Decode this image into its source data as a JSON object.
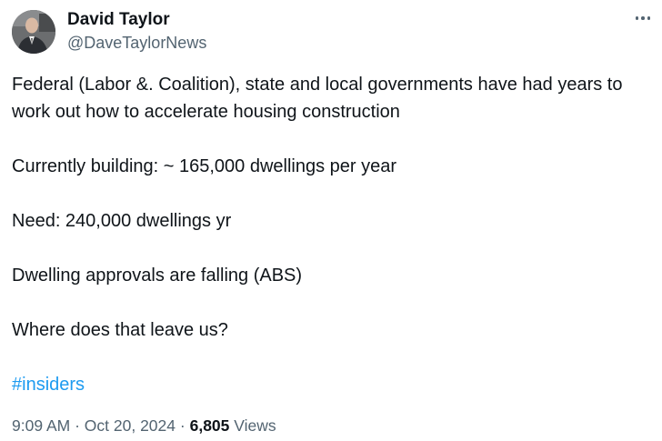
{
  "author": {
    "display_name": "David Taylor",
    "handle": "@DaveTaylorNews"
  },
  "more_menu": {
    "icon": "more-horizontal-icon"
  },
  "tweet": {
    "paragraphs": [
      "Federal (Labor &. Coalition), state and local governments have had years to work out how to accelerate housing construction",
      "Currently building: ~ 165,000 dwellings per year",
      "Need: 240,000 dwellings yr",
      "Dwelling approvals are falling (ABS)",
      "Where does that leave us?"
    ],
    "hashtag": "#insiders"
  },
  "meta": {
    "time": "9:09 AM",
    "separator": "·",
    "date": "Oct 20, 2024",
    "views_count": "6,805",
    "views_label": "Views"
  },
  "colors": {
    "text": "#0f1419",
    "secondary": "#536471",
    "link": "#1d9bf0"
  }
}
